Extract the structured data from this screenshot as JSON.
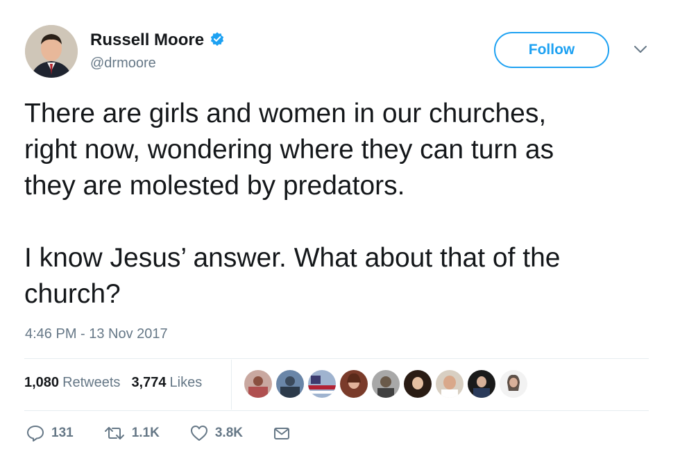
{
  "user": {
    "name": "Russell Moore",
    "handle": "@drmoore",
    "verified_icon": "verified-badge-icon"
  },
  "follow_button": {
    "label": "Follow"
  },
  "menu": {
    "icon": "chevron-down-icon"
  },
  "tweet": {
    "text": "There are girls and women in our churches,\nright now, wondering where they can turn as\nthey are molested by predators.\n\nI know Jesus’ answer. What about that of the\nchurch?",
    "timestamp": "4:46 PM - 13 Nov 2017"
  },
  "stats": {
    "retweets_count": "1,080",
    "retweets_label": "Retweets",
    "likes_count": "3,774",
    "likes_label": "Likes"
  },
  "actions": {
    "reply_count": "131",
    "retweet_count": "1.1K",
    "like_count": "3.8K"
  },
  "colors": {
    "accent": "#1da1f2",
    "text": "#14171a",
    "muted": "#657786",
    "divider": "#e6ecf0"
  }
}
